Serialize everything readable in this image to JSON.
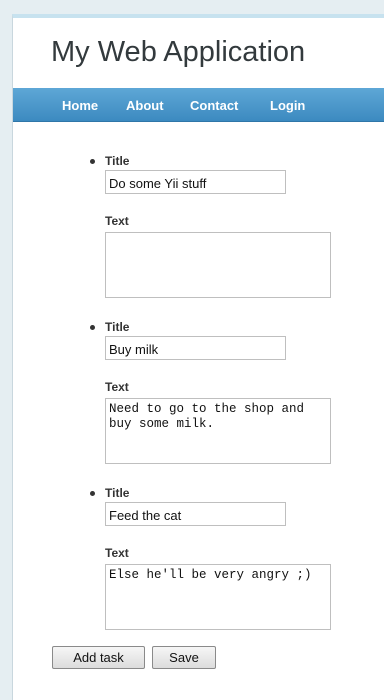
{
  "app": {
    "title": "My Web Application"
  },
  "menu": {
    "items": [
      {
        "label": "Home"
      },
      {
        "label": "About"
      },
      {
        "label": "Contact"
      },
      {
        "label": "Login"
      }
    ]
  },
  "form": {
    "title_label": "Title",
    "text_label": "Text",
    "tasks": [
      {
        "title": "Do some Yii stuff",
        "text": ""
      },
      {
        "title": "Buy milk",
        "text": "Need to go to the shop and buy some milk."
      },
      {
        "title": "Feed the cat",
        "text": "Else he'll be very angry ;)"
      }
    ],
    "add_label": "Add task",
    "save_label": "Save"
  }
}
